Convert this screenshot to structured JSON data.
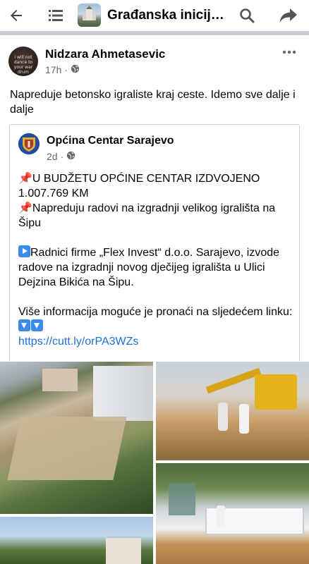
{
  "topbar": {
    "group_title": "Građanska inicijati…"
  },
  "post": {
    "author": "Nidzara Ahmetasevic",
    "avatar_text": "i will not dance to your war drum",
    "time": "17h",
    "separator": "·",
    "text": "Napreduje betonsko igraliste kraj ceste. Idemo sve dalje i dalje"
  },
  "shared": {
    "author": "Općina Centar Sarajevo",
    "time": "2d",
    "separator": "·",
    "line1": "U BUDŽETU OPĆINE CENTAR IZDVOJENO 1.007.769 KM",
    "line2": "Napreduju radovi na izgradnji velikog igrališta na Šipu",
    "para2": "Radnici firme „Flex Invest“ d.o.o. Sarajevo, izvode radove na izgradnji novog dječijeg igrališta u Ulici Dejzina Bikića na Šipu.",
    "para3": "Više informacija moguće je pronaći na sljedećem linku:",
    "link": "https://cutt.ly/orPA3WZs"
  },
  "photos": [
    "aerial-construction-site",
    "excavator-workers",
    "town-view",
    "pool-construction"
  ],
  "icons": [
    "back-arrow-icon",
    "menu-icon",
    "search-icon",
    "share-icon",
    "globe-icon",
    "more-icon",
    "pin-icon",
    "play-icon",
    "down-arrow-icon"
  ],
  "colors": {
    "link": "#216fdb",
    "meta": "#65676b",
    "divider": "#c9ccd1"
  }
}
